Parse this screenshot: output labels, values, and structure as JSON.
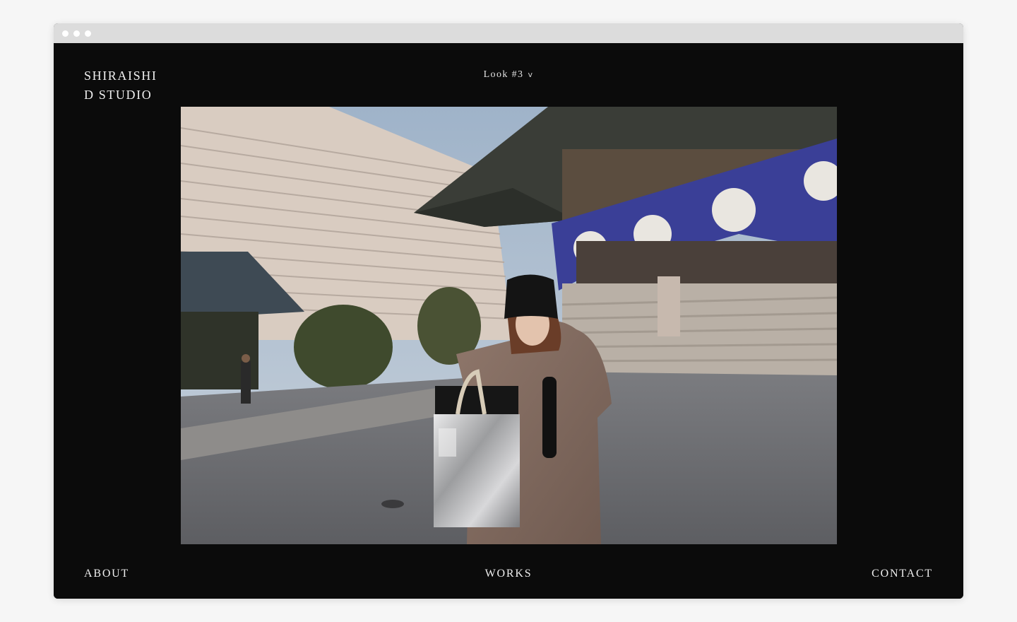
{
  "window": {
    "controls": [
      "dot",
      "dot",
      "dot"
    ]
  },
  "brand": {
    "line1": "SHIRAISHI",
    "line2": "D STUDIO"
  },
  "look_selector": {
    "label": "Look #3",
    "chevron": "v"
  },
  "photo": {
    "subject": "photo-icon"
  },
  "nav": {
    "about": "ABOUT",
    "works": "WORKS",
    "contact": "CONTACT"
  },
  "colors": {
    "page_bg": "#0b0b0b",
    "text": "#efefef",
    "frame": "#dcdcdc"
  }
}
